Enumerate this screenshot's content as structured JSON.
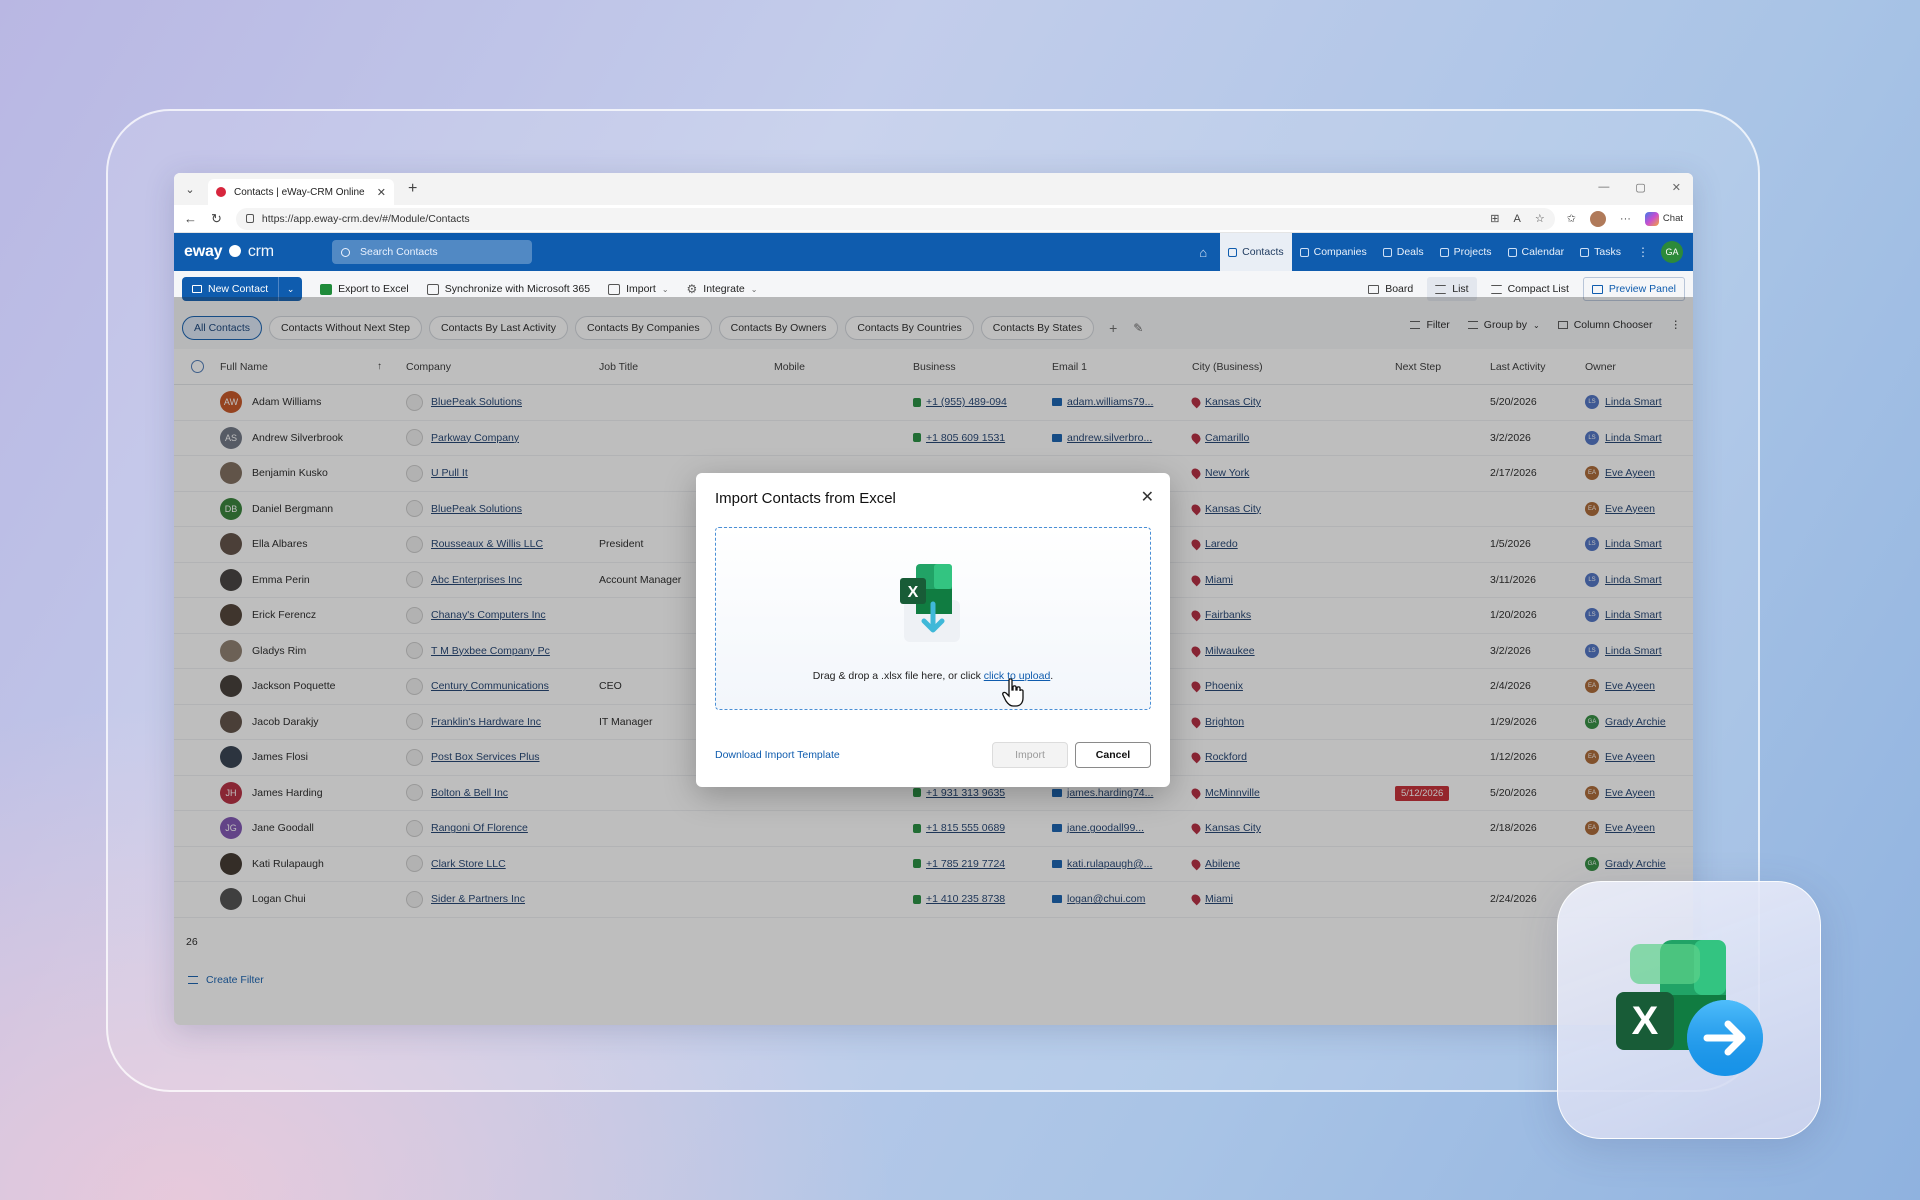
{
  "browser": {
    "tab_title": "Contacts | eWay-CRM Online",
    "url": "https://app.eway-crm.dev/#/Module/Contacts",
    "chat_label": "Chat"
  },
  "app": {
    "logo_main": "eway",
    "logo_suffix": "crm",
    "search_placeholder": "Search Contacts",
    "nav": [
      "Contacts",
      "Companies",
      "Deals",
      "Projects",
      "Calendar",
      "Tasks"
    ],
    "user_initials": "GA"
  },
  "toolbar": {
    "new_contact": "New Contact",
    "export_excel": "Export to Excel",
    "sync_m365": "Synchronize with Microsoft 365",
    "import": "Import",
    "integrate": "Integrate",
    "board": "Board",
    "list": "List",
    "compact_list": "Compact List",
    "preview_panel": "Preview Panel"
  },
  "filters": {
    "chips": [
      "All Contacts",
      "Contacts Without Next Step",
      "Contacts By Last Activity",
      "Contacts By Companies",
      "Contacts By Owners",
      "Contacts By Countries",
      "Contacts By States"
    ],
    "filter": "Filter",
    "group_by": "Group by",
    "column_chooser": "Column Chooser"
  },
  "table": {
    "headers": {
      "full_name": "Full Name",
      "company": "Company",
      "job_title": "Job Title",
      "mobile": "Mobile",
      "business": "Business",
      "email": "Email 1",
      "city": "City (Business)",
      "next_step": "Next Step",
      "last_activity": "Last Activity",
      "owner": "Owner"
    },
    "rows": [
      {
        "initials": "AW",
        "avatar_color": "#c4501e",
        "name": "Adam Williams",
        "company": "BluePeak Solutions",
        "job": "",
        "phone": "+1 (955) 489-094",
        "email": "adam.williams79...",
        "city": "Kansas City",
        "next": "",
        "last": "5/20/2026",
        "owner_initials": "LS",
        "owner_color": "#4a6fc2",
        "owner": "Linda Smart"
      },
      {
        "initials": "AS",
        "avatar_color": "#6b7280",
        "name": "Andrew Silverbrook",
        "company": "Parkway Company",
        "job": "",
        "phone": "+1 805 609 1531",
        "email": "andrew.silverbro...",
        "city": "Camarillo",
        "next": "",
        "last": "3/2/2026",
        "owner_initials": "LS",
        "owner_color": "#4a6fc2",
        "owner": "Linda Smart"
      },
      {
        "initials": "",
        "avatar_color": "#7a6858",
        "name": "Benjamin Kusko",
        "company": "U Pull It",
        "job": "",
        "phone": "",
        "email": "",
        "city": "New York",
        "next": "",
        "last": "2/17/2026",
        "owner_initials": "EA",
        "owner_color": "#a8632f",
        "owner": "Eve Ayeen"
      },
      {
        "initials": "DB",
        "avatar_color": "#2f7d32",
        "name": "Daniel Bergmann",
        "company": "BluePeak Solutions",
        "job": "",
        "phone": "",
        "email": "",
        "city": "Kansas City",
        "next": "",
        "last": "",
        "owner_initials": "EA",
        "owner_color": "#a8632f",
        "owner": "Eve Ayeen"
      },
      {
        "initials": "",
        "avatar_color": "#5b4a3f",
        "name": "Ella Albares",
        "company": "Rousseaux & Willis LLC",
        "job": "President",
        "phone": "",
        "email": "",
        "city": "Laredo",
        "next": "",
        "last": "1/5/2026",
        "owner_initials": "LS",
        "owner_color": "#4a6fc2",
        "owner": "Linda Smart"
      },
      {
        "initials": "",
        "avatar_color": "#3e3a38",
        "name": "Emma Perin",
        "company": "Abc Enterprises Inc",
        "job": "Account Manager",
        "phone": "",
        "email": "",
        "city": "Miami",
        "next": "",
        "last": "3/11/2026",
        "owner_initials": "LS",
        "owner_color": "#4a6fc2",
        "owner": "Linda Smart"
      },
      {
        "initials": "",
        "avatar_color": "#4a3b30",
        "name": "Erick Ferencz",
        "company": "Chanay's Computers Inc",
        "job": "",
        "phone": "",
        "email": "",
        "city": "Fairbanks",
        "next": "",
        "last": "1/20/2026",
        "owner_initials": "LS",
        "owner_color": "#4a6fc2",
        "owner": "Linda Smart"
      },
      {
        "initials": "",
        "avatar_color": "#8a7a6a",
        "name": "Gladys Rim",
        "company": "T M Byxbee Company Pc",
        "job": "",
        "phone": "",
        "email": "",
        "city": "Milwaukee",
        "next": "",
        "last": "3/2/2026",
        "owner_initials": "LS",
        "owner_color": "#4a6fc2",
        "owner": "Linda Smart"
      },
      {
        "initials": "",
        "avatar_color": "#3d3530",
        "name": "Jackson Poquette",
        "company": "Century Communications",
        "job": "CEO",
        "phone": "",
        "email": "",
        "city": "Phoenix",
        "next": "",
        "last": "2/4/2026",
        "owner_initials": "EA",
        "owner_color": "#a8632f",
        "owner": "Eve Ayeen"
      },
      {
        "initials": "",
        "avatar_color": "#5a4a40",
        "name": "Jacob Darakjy",
        "company": "Franklin's Hardware Inc",
        "job": "IT Manager",
        "phone": "",
        "email": "",
        "city": "Brighton",
        "next": "",
        "last": "1/29/2026",
        "owner_initials": "GA",
        "owner_color": "#2c8a3a",
        "owner": "Grady Archie"
      },
      {
        "initials": "",
        "avatar_color": "#2f3a4a",
        "name": "James Flosi",
        "company": "Post Box Services Plus",
        "job": "",
        "phone": "",
        "email": "",
        "city": "Rockford",
        "next": "",
        "last": "1/12/2026",
        "owner_initials": "EA",
        "owner_color": "#a8632f",
        "owner": "Eve Ayeen"
      },
      {
        "initials": "JH",
        "avatar_color": "#b3263a",
        "name": "James Harding",
        "company": "Bolton & Bell Inc",
        "job": "",
        "phone": "+1 931 313 9635",
        "email": "james.harding74...",
        "city": "McMinnville",
        "next": "5/12/2026",
        "last": "5/20/2026",
        "owner_initials": "EA",
        "owner_color": "#a8632f",
        "owner": "Eve Ayeen"
      },
      {
        "initials": "JG",
        "avatar_color": "#7b4fb0",
        "name": "Jane Goodall",
        "company": "Rangoni Of Florence",
        "job": "",
        "phone": "+1 815 555 0689",
        "email": "jane.goodall99...",
        "city": "Kansas City",
        "next": "",
        "last": "2/18/2026",
        "owner_initials": "EA",
        "owner_color": "#a8632f",
        "owner": "Eve Ayeen"
      },
      {
        "initials": "",
        "avatar_color": "#3a3028",
        "name": "Kati Rulapaugh",
        "company": "Clark Store LLC",
        "job": "",
        "phone": "+1 785 219 7724",
        "email": "kati.rulapaugh@...",
        "city": "Abilene",
        "next": "",
        "last": "",
        "owner_initials": "GA",
        "owner_color": "#2c8a3a",
        "owner": "Grady Archie"
      },
      {
        "initials": "",
        "avatar_color": "#4a4a4a",
        "name": "Logan Chui",
        "company": "Sider & Partners Inc",
        "job": "",
        "phone": "+1 410 235 8738",
        "email": "logan@chui.com",
        "city": "Miami",
        "next": "",
        "last": "2/24/2026",
        "owner_initials": "",
        "owner_color": "#4a6fc2",
        "owner": ""
      }
    ],
    "count": "26",
    "create_filter": "Create Filter"
  },
  "modal": {
    "title": "Import Contacts from Excel",
    "drop_text": "Drag & drop a .xlsx file here, or click ",
    "upload_link": "click to upload",
    "drop_end": ".",
    "download_template": "Download Import Template",
    "import_btn": "Import",
    "cancel_btn": "Cancel"
  },
  "colors": {
    "brand": "#0f5cae",
    "excel_green": "#1f8b3a",
    "badge_red": "#c4262e"
  }
}
